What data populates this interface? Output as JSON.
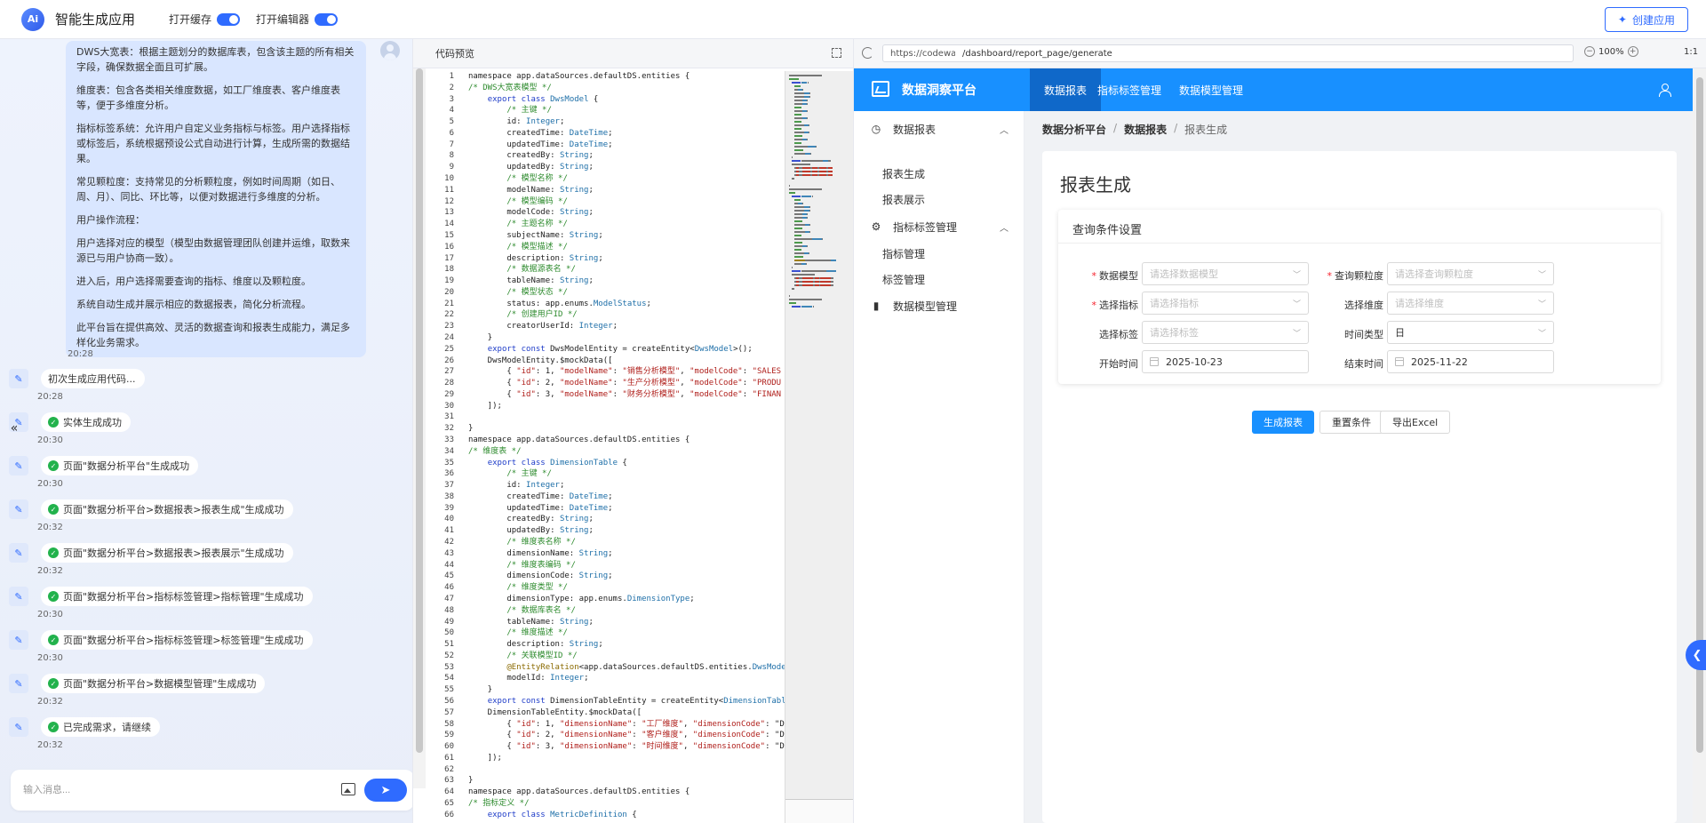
{
  "topbar": {
    "logo_text": "Ai",
    "app_title": "智能生成应用",
    "toggle_cache_label": "打开缓存",
    "toggle_editor_label": "打开编辑器",
    "create_button": "创建应用",
    "accent_color": "#2f6bff"
  },
  "chat": {
    "user_message": [
      "DWS大宽表：根据主题划分的数据库表，包含该主题的所有相关字段，确保数据全面且可扩展。",
      "维度表：包含各类相关维度数据，如工厂维度表、客户维度表等，便于多维度分析。",
      "指标标签系统：允许用户自定义业务指标与标签。用户选择指标或标签后，系统根据预设公式自动进行计算，生成所需的数据结果。",
      "常见颗粒度：支持常见的分析颗粒度，例如时间周期（如日、周、月）、同比、环比等，以便对数据进行多维度的分析。",
      "用户操作流程：",
      "用户选择对应的模型（模型由数据管理团队创建并运维，取数来源已与用户协商一致）。",
      "进入后，用户选择需要查询的指标、维度以及颗粒度。",
      "系统自动生成并展示相应的数据报表，简化分析流程。",
      "此平台旨在提供高效、灵活的数据查询和报表生成能力，满足多样化业务需求。"
    ],
    "user_message_time": "20:28",
    "bot_messages": [
      {
        "text": "初次生成应用代码...",
        "time": "20:28",
        "success": false
      },
      {
        "text": "实体生成成功",
        "time": "20:30",
        "success": true
      },
      {
        "text": "页面\"数据分析平台\"生成成功",
        "time": "20:30",
        "success": true
      },
      {
        "text": "页面\"数据分析平台>数据报表>报表生成\"生成成功",
        "time": "20:32",
        "success": true
      },
      {
        "text": "页面\"数据分析平台>数据报表>报表展示\"生成成功",
        "time": "20:32",
        "success": true
      },
      {
        "text": "页面\"数据分析平台>指标标签管理>指标管理\"生成成功",
        "time": "20:30",
        "success": true
      },
      {
        "text": "页面\"数据分析平台>指标标签管理>标签管理\"生成成功",
        "time": "20:30",
        "success": true
      },
      {
        "text": "页面\"数据分析平台>数据模型管理\"生成成功",
        "time": "20:32",
        "success": true
      },
      {
        "text": "已完成需求，请继续",
        "time": "20:32",
        "success": true
      }
    ],
    "input_placeholder": "输入消息..."
  },
  "code_preview": {
    "title": "代码预览",
    "lines": [
      [
        [
          "",
          "namespace app.dataSources.defaultDS.entities {"
        ]
      ],
      [
        [
          "c",
          "/* DWS大宽表模型 */"
        ]
      ],
      [
        [
          "",
          "    "
        ],
        [
          "k",
          "export class"
        ],
        [
          "",
          " "
        ],
        [
          "t",
          "DwsModel"
        ],
        [
          "",
          " {"
        ]
      ],
      [
        [
          "c",
          "        /* 主键 */"
        ]
      ],
      [
        [
          "",
          "        id: "
        ],
        [
          "t",
          "Integer"
        ],
        [
          "",
          ";"
        ]
      ],
      [
        [
          "",
          "        createdTime: "
        ],
        [
          "t",
          "DateTime"
        ],
        [
          "",
          ";"
        ]
      ],
      [
        [
          "",
          "        updatedTime: "
        ],
        [
          "t",
          "DateTime"
        ],
        [
          "",
          ";"
        ]
      ],
      [
        [
          "",
          "        createdBy: "
        ],
        [
          "t",
          "String"
        ],
        [
          "",
          ";"
        ]
      ],
      [
        [
          "",
          "        updatedBy: "
        ],
        [
          "t",
          "String"
        ],
        [
          "",
          ";"
        ]
      ],
      [
        [
          "c",
          "        /* 模型名称 */"
        ]
      ],
      [
        [
          "",
          "        modelName: "
        ],
        [
          "t",
          "String"
        ],
        [
          "",
          ";"
        ]
      ],
      [
        [
          "c",
          "        /* 模型编码 */"
        ]
      ],
      [
        [
          "",
          "        modelCode: "
        ],
        [
          "t",
          "String"
        ],
        [
          "",
          ";"
        ]
      ],
      [
        [
          "c",
          "        /* 主题名称 */"
        ]
      ],
      [
        [
          "",
          "        subjectName: "
        ],
        [
          "t",
          "String"
        ],
        [
          "",
          ";"
        ]
      ],
      [
        [
          "c",
          "        /* 模型描述 */"
        ]
      ],
      [
        [
          "",
          "        description: "
        ],
        [
          "t",
          "String"
        ],
        [
          "",
          ";"
        ]
      ],
      [
        [
          "c",
          "        /* 数据源表名 */"
        ]
      ],
      [
        [
          "",
          "        tableName: "
        ],
        [
          "t",
          "String"
        ],
        [
          "",
          ";"
        ]
      ],
      [
        [
          "c",
          "        /* 模型状态 */"
        ]
      ],
      [
        [
          "",
          "        status: app.enums."
        ],
        [
          "t",
          "ModelStatus"
        ],
        [
          "",
          ";"
        ]
      ],
      [
        [
          "c",
          "        /* 创建用户ID */"
        ]
      ],
      [
        [
          "",
          "        creatorUserId: "
        ],
        [
          "t",
          "Integer"
        ],
        [
          "",
          ";"
        ]
      ],
      [
        [
          "",
          "    }"
        ]
      ],
      [
        [
          "",
          "    "
        ],
        [
          "k",
          "export const"
        ],
        [
          "",
          " DwsModelEntity = createEntity<"
        ],
        [
          "t",
          "DwsModel"
        ],
        [
          "",
          ">();"
        ]
      ],
      [
        [
          "",
          "    DwsModelEntity.$mockData(["
        ]
      ],
      [
        [
          "",
          "        { "
        ],
        [
          "s",
          "\"id\""
        ],
        [
          "",
          ": 1, "
        ],
        [
          "s",
          "\"modelName\""
        ],
        [
          "",
          ": "
        ],
        [
          "s",
          "\"销售分析模型\""
        ],
        [
          "",
          ", "
        ],
        [
          "s",
          "\"modelCode\""
        ],
        [
          "",
          ": "
        ],
        [
          "s",
          "\"SALES"
        ]
      ],
      [
        [
          "",
          "        { "
        ],
        [
          "s",
          "\"id\""
        ],
        [
          "",
          ": 2, "
        ],
        [
          "s",
          "\"modelName\""
        ],
        [
          "",
          ": "
        ],
        [
          "s",
          "\"生产分析模型\""
        ],
        [
          "",
          ", "
        ],
        [
          "s",
          "\"modelCode\""
        ],
        [
          "",
          ": "
        ],
        [
          "s",
          "\"PRODU"
        ]
      ],
      [
        [
          "",
          "        { "
        ],
        [
          "s",
          "\"id\""
        ],
        [
          "",
          ": 3, "
        ],
        [
          "s",
          "\"modelName\""
        ],
        [
          "",
          ": "
        ],
        [
          "s",
          "\"财务分析模型\""
        ],
        [
          "",
          ", "
        ],
        [
          "s",
          "\"modelCode\""
        ],
        [
          "",
          ": "
        ],
        [
          "s",
          "\"FINAN"
        ]
      ],
      [
        [
          "",
          "    ]);"
        ]
      ],
      [
        [
          "",
          ""
        ]
      ],
      [
        [
          "",
          "}"
        ]
      ],
      [
        [
          "",
          "namespace app.dataSources.defaultDS.entities {"
        ]
      ],
      [
        [
          "c",
          "/* 维度表 */"
        ]
      ],
      [
        [
          "",
          "    "
        ],
        [
          "k",
          "export class"
        ],
        [
          "",
          " "
        ],
        [
          "t",
          "DimensionTable"
        ],
        [
          "",
          " {"
        ]
      ],
      [
        [
          "c",
          "        /* 主键 */"
        ]
      ],
      [
        [
          "",
          "        id: "
        ],
        [
          "t",
          "Integer"
        ],
        [
          "",
          ";"
        ]
      ],
      [
        [
          "",
          "        createdTime: "
        ],
        [
          "t",
          "DateTime"
        ],
        [
          "",
          ";"
        ]
      ],
      [
        [
          "",
          "        updatedTime: "
        ],
        [
          "t",
          "DateTime"
        ],
        [
          "",
          ";"
        ]
      ],
      [
        [
          "",
          "        createdBy: "
        ],
        [
          "t",
          "String"
        ],
        [
          "",
          ";"
        ]
      ],
      [
        [
          "",
          "        updatedBy: "
        ],
        [
          "t",
          "String"
        ],
        [
          "",
          ";"
        ]
      ],
      [
        [
          "c",
          "        /* 维度表名称 */"
        ]
      ],
      [
        [
          "",
          "        dimensionName: "
        ],
        [
          "t",
          "String"
        ],
        [
          "",
          ";"
        ]
      ],
      [
        [
          "c",
          "        /* 维度表编码 */"
        ]
      ],
      [
        [
          "",
          "        dimensionCode: "
        ],
        [
          "t",
          "String"
        ],
        [
          "",
          ";"
        ]
      ],
      [
        [
          "c",
          "        /* 维度类型 */"
        ]
      ],
      [
        [
          "",
          "        dimensionType: app.enums."
        ],
        [
          "t",
          "DimensionType"
        ],
        [
          "",
          ";"
        ]
      ],
      [
        [
          "c",
          "        /* 数据库表名 */"
        ]
      ],
      [
        [
          "",
          "        tableName: "
        ],
        [
          "t",
          "String"
        ],
        [
          "",
          ";"
        ]
      ],
      [
        [
          "c",
          "        /* 维度描述 */"
        ]
      ],
      [
        [
          "",
          "        description: "
        ],
        [
          "t",
          "String"
        ],
        [
          "",
          ";"
        ]
      ],
      [
        [
          "c",
          "        /* 关联模型ID */"
        ]
      ],
      [
        [
          "d",
          "        @EntityRelation"
        ],
        [
          "",
          "<app.dataSources.defaultDS.entities."
        ],
        [
          "t",
          "DwsMode"
        ]
      ],
      [
        [
          "",
          "        modelId: "
        ],
        [
          "t",
          "Integer"
        ],
        [
          "",
          ";"
        ]
      ],
      [
        [
          "",
          "    }"
        ]
      ],
      [
        [
          "",
          "    "
        ],
        [
          "k",
          "export const"
        ],
        [
          "",
          " DimensionTableEntity = createEntity<"
        ],
        [
          "t",
          "DimensionTabl"
        ]
      ],
      [
        [
          "",
          "    DimensionTableEntity.$mockData(["
        ]
      ],
      [
        [
          "",
          "        { "
        ],
        [
          "s",
          "\"id\""
        ],
        [
          "",
          ": 1, "
        ],
        [
          "s",
          "\"dimensionName\""
        ],
        [
          "",
          ": "
        ],
        [
          "s",
          "\"工厂维度\""
        ],
        [
          "",
          ", "
        ],
        [
          "s",
          "\"dimensionCode\""
        ],
        [
          "",
          ": \"D"
        ]
      ],
      [
        [
          "",
          "        { "
        ],
        [
          "s",
          "\"id\""
        ],
        [
          "",
          ": 2, "
        ],
        [
          "s",
          "\"dimensionName\""
        ],
        [
          "",
          ": "
        ],
        [
          "s",
          "\"客户维度\""
        ],
        [
          "",
          ", "
        ],
        [
          "s",
          "\"dimensionCode\""
        ],
        [
          "",
          ": \"D"
        ]
      ],
      [
        [
          "",
          "        { "
        ],
        [
          "s",
          "\"id\""
        ],
        [
          "",
          ": 3, "
        ],
        [
          "s",
          "\"dimensionName\""
        ],
        [
          "",
          ": "
        ],
        [
          "s",
          "\"时间维度\""
        ],
        [
          "",
          ", "
        ],
        [
          "s",
          "\"dimensionCode\""
        ],
        [
          "",
          ": \"D"
        ]
      ],
      [
        [
          "",
          "    ]);"
        ]
      ],
      [
        [
          "",
          ""
        ]
      ],
      [
        [
          "",
          "}"
        ]
      ],
      [
        [
          "",
          "namespace app.dataSources.defaultDS.entities {"
        ]
      ],
      [
        [
          "c",
          "/* 指标定义 */"
        ]
      ],
      [
        [
          "",
          "    "
        ],
        [
          "k",
          "export class"
        ],
        [
          "",
          " "
        ],
        [
          "t",
          "MetricDefinition"
        ],
        [
          "",
          " {"
        ]
      ]
    ]
  },
  "preview": {
    "url_host": "https://codewave.ai",
    "url_path": "/dashboard/report_page/generate",
    "zoom": "100%",
    "ratio": "1:1",
    "app_name": "数据洞察平台",
    "nav": [
      "数据报表",
      "指标标签管理",
      "数据模型管理"
    ],
    "nav_active": 0,
    "header_color": "#1890ff",
    "sidebar": {
      "group1": "数据报表",
      "group1_items": [
        "报表生成",
        "报表展示"
      ],
      "group2": "指标标签管理",
      "group2_items": [
        "指标管理",
        "标签管理"
      ],
      "group3": "数据模型管理"
    },
    "breadcrumb": [
      "数据分析平台",
      "数据报表",
      "报表生成"
    ],
    "page_title": "报表生成",
    "form": {
      "title": "查询条件设置",
      "model_label": "数据模型",
      "model_placeholder": "请选择数据模型",
      "granularity_label": "查询颗粒度",
      "granularity_placeholder": "请选择查询颗粒度",
      "metric_label": "选择指标",
      "metric_placeholder": "请选择指标",
      "dimension_label": "选择维度",
      "dimension_placeholder": "请选择维度",
      "tag_label": "选择标签",
      "tag_placeholder": "请选择标签",
      "time_type_label": "时间类型",
      "time_type_value": "日",
      "start_label": "开始时间",
      "start_value": "2025-10-23",
      "end_label": "结束时间",
      "end_value": "2025-11-22"
    },
    "buttons": {
      "generate": "生成报表",
      "reset": "重置条件",
      "export": "导出Excel"
    }
  }
}
